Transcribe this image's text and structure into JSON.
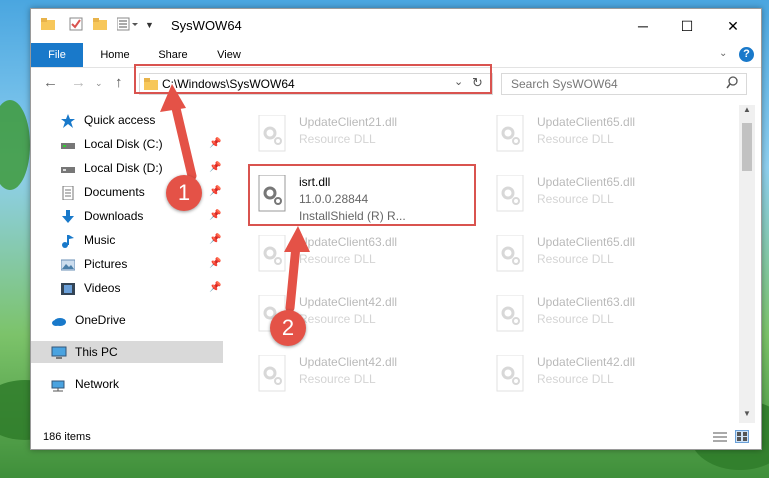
{
  "window": {
    "title": "SysWOW64",
    "minimize": "─",
    "maximize": "☐",
    "close": "✕"
  },
  "ribbon": {
    "tabs": [
      {
        "label": "File"
      },
      {
        "label": "Home"
      },
      {
        "label": "Share"
      },
      {
        "label": "View"
      }
    ],
    "help": "?"
  },
  "address": {
    "path": "C:\\Windows\\SysWOW64",
    "search_placeholder": "Search SysWOW64"
  },
  "nav": {
    "items": [
      {
        "label": "Quick access",
        "icon": "star-icon"
      },
      {
        "label": "Local Disk (C:)",
        "icon": "drive-icon"
      },
      {
        "label": "Local Disk (D:)",
        "icon": "drive-icon"
      },
      {
        "label": "Documents",
        "icon": "documents-icon"
      },
      {
        "label": "Downloads",
        "icon": "download-icon"
      },
      {
        "label": "Music",
        "icon": "music-icon"
      },
      {
        "label": "Pictures",
        "icon": "pictures-icon"
      },
      {
        "label": "Videos",
        "icon": "videos-icon"
      },
      {
        "label": "OneDrive",
        "icon": "cloud-icon"
      },
      {
        "label": "This PC",
        "icon": "computer-icon"
      },
      {
        "label": "Network",
        "icon": "network-icon"
      }
    ]
  },
  "files": {
    "col1": [
      {
        "name": "UpdateClient21.dll",
        "desc": "Resource DLL"
      },
      {
        "name": "UpdateClient63.dll",
        "desc": "Resource DLL"
      },
      {
        "name": "UpdateClient42.dll",
        "desc": "Resource DLL"
      },
      {
        "name": "UpdateClient42.dll",
        "desc": "Resource DLL"
      }
    ],
    "col2": [
      {
        "name": "UpdateClient65.dll",
        "desc": "Resource DLL"
      },
      {
        "name": "UpdateClient65.dll",
        "desc": "Resource DLL"
      },
      {
        "name": "UpdateClient65.dll",
        "desc": "Resource DLL"
      },
      {
        "name": "UpdateClient63.dll",
        "desc": "Resource DLL"
      },
      {
        "name": "UpdateClient42.dll",
        "desc": "Resource DLL"
      }
    ],
    "highlight": {
      "name": "isrt.dll",
      "version": "11.0.0.28844",
      "desc": "InstallShield (R) R..."
    }
  },
  "status": {
    "count": "186 items"
  },
  "markers": {
    "one": "1",
    "two": "2"
  },
  "colors": {
    "accent": "#1979ca",
    "annotation": "#d9534f"
  }
}
